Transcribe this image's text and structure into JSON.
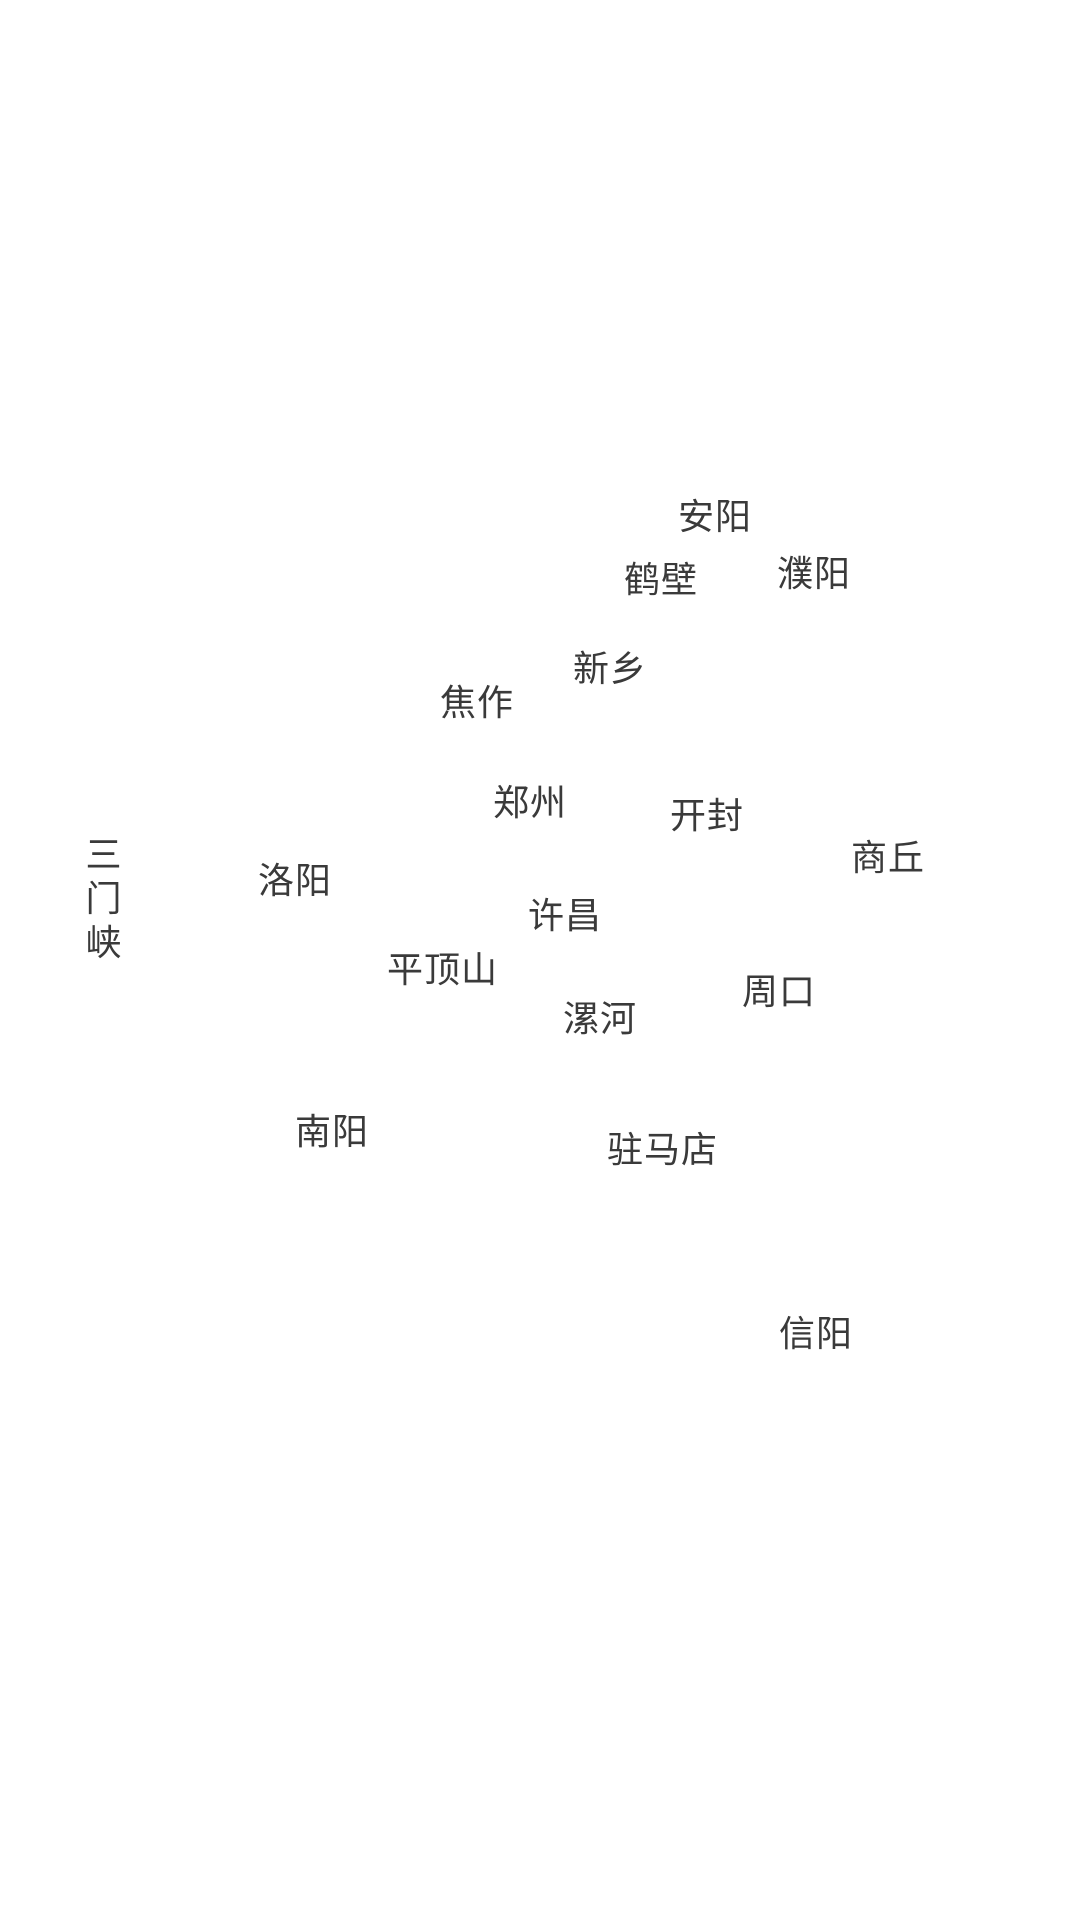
{
  "map": {
    "cities": {
      "anyang": "安阳",
      "hebi": "鹤壁",
      "puyang": "濮阳",
      "xinxiang": "新乡",
      "jiaozuo": "焦作",
      "zhengzhou": "郑州",
      "kaifeng": "开封",
      "shangqiu": "商丘",
      "luoyang": "洛阳",
      "sanmenxia": "三门峡",
      "xuchang": "许昌",
      "pingdingshan": "平顶山",
      "zhoukou": "周口",
      "luohe": "漯河",
      "nanyang": "南阳",
      "zhumadian": "驻马店",
      "xinyang": "信阳"
    },
    "label_color": "#3a3a3a",
    "background_color": "#ffffff"
  }
}
